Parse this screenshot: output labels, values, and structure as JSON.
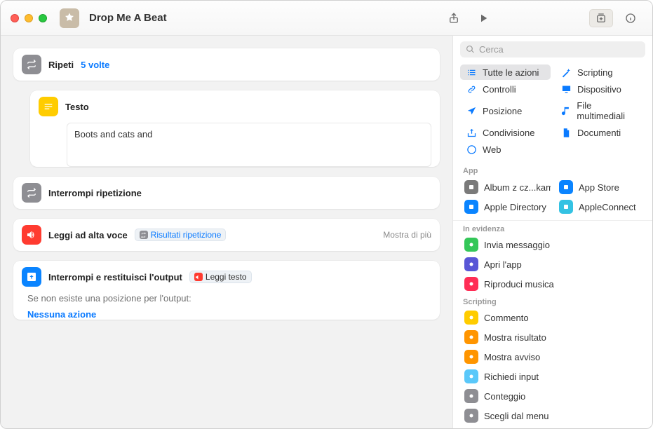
{
  "window": {
    "title": "Drop Me A Beat"
  },
  "toolbar": {},
  "editor": {
    "repeat": {
      "label": "Ripeti",
      "count_label": "5 volte"
    },
    "text": {
      "label": "Testo",
      "value": "Boots and cats and"
    },
    "end_repeat": {
      "label": "Interrompi ripetizione"
    },
    "speak": {
      "label": "Leggi ad alta voce",
      "token": "Risultati ripetizione",
      "show_more": "Mostra di più"
    },
    "stop": {
      "label": "Interrompi e restituisci l'output",
      "token": "Leggi testo",
      "sub_prompt": "Se non esiste una posizione per l'output:",
      "sub_action": "Nessuna azione"
    }
  },
  "sidebar": {
    "search_placeholder": "Cerca",
    "categories": [
      {
        "label": "Tutte le azioni",
        "icon": "list",
        "selected": true
      },
      {
        "label": "Scripting",
        "icon": "wand"
      },
      {
        "label": "Controlli",
        "icon": "link"
      },
      {
        "label": "Dispositivo",
        "icon": "desktop"
      },
      {
        "label": "Posizione",
        "icon": "location"
      },
      {
        "label": "File multimediali",
        "icon": "music"
      },
      {
        "label": "Condivisione",
        "icon": "share"
      },
      {
        "label": "Documenti",
        "icon": "doc"
      },
      {
        "label": "Web",
        "icon": "safari"
      }
    ],
    "apps_header": "App",
    "apps": [
      {
        "label": "Album z cz...kami",
        "color": "#7a7a7a"
      },
      {
        "label": "App Store",
        "color": "#0a84ff"
      },
      {
        "label": "Apple Directory",
        "color": "#0a84ff"
      },
      {
        "label": "AppleConnect",
        "color": "#34c2e3"
      }
    ],
    "featured_header": "In evidenza",
    "featured": [
      {
        "label": "Invia messaggio",
        "color": "#34c759"
      },
      {
        "label": "Apri l'app",
        "color": "#5856d6"
      },
      {
        "label": "Riproduci musica",
        "color": "#ff2d55"
      }
    ],
    "scripting_header": "Scripting",
    "scripting": [
      {
        "label": "Commento",
        "color": "#ffcc00"
      },
      {
        "label": "Mostra risultato",
        "color": "#ff9500"
      },
      {
        "label": "Mostra avviso",
        "color": "#ff9500"
      },
      {
        "label": "Richiedi input",
        "color": "#5ac8fa"
      },
      {
        "label": "Conteggio",
        "color": "#8e8e93"
      },
      {
        "label": "Scegli dal menu",
        "color": "#8e8e93"
      }
    ]
  }
}
